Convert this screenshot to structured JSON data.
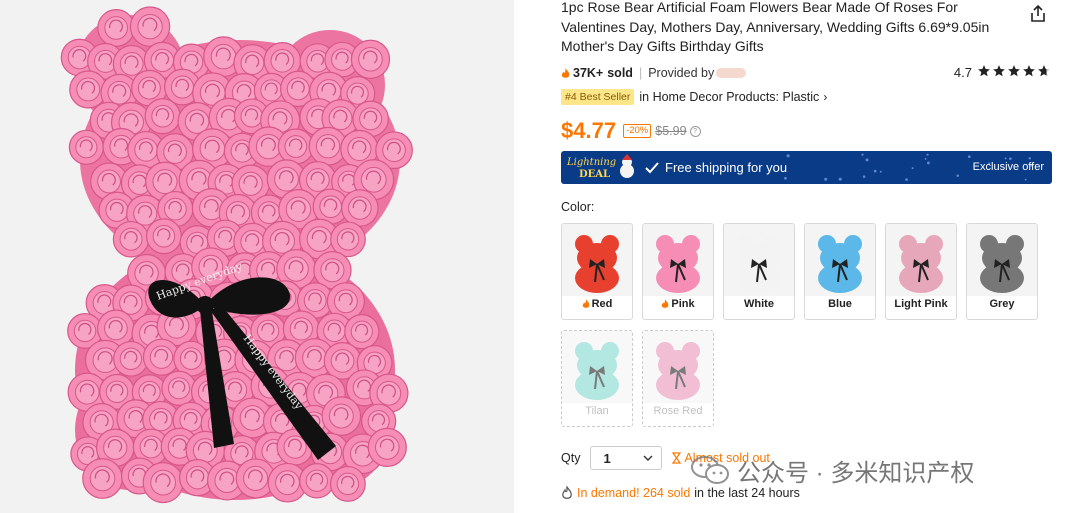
{
  "product": {
    "title": "1pc Rose Bear Artificial Foam Flowers Bear Made Of Roses For Valentines Day, Mothers Day, Anniversary, Wedding Gifts 6.69*9.05in Mother's Day Gifts Birthday Gifts",
    "sold_count": "37K+",
    "sold_label": "sold",
    "provided_by": "Provided by",
    "rating": "4.7",
    "stars_value": 4.7,
    "best_seller_badge": "#4 Best Seller",
    "best_seller_category": "in Home Decor Products: Plastic",
    "price": "$4.77",
    "discount": "-20%",
    "original_price": "$5.99",
    "info_symbol": "?"
  },
  "banner": {
    "lightning": "Lightning",
    "deal": "DEAL",
    "free_shipping": "Free shipping for you",
    "exclusive": "Exclusive offer",
    "background_color": "#0a3b86"
  },
  "color_label": "Color:",
  "colors": [
    {
      "label": "Red",
      "hot": true,
      "available": true,
      "color": "#e8402e",
      "bow": "#222222"
    },
    {
      "label": "Pink",
      "hot": true,
      "available": true,
      "color": "#f58db4",
      "bow": "#222222"
    },
    {
      "label": "White",
      "hot": false,
      "available": true,
      "color": "#f3f3f3",
      "bow": "#222222"
    },
    {
      "label": "Blue",
      "hot": false,
      "available": true,
      "color": "#5bb8e8",
      "bow": "#222222"
    },
    {
      "label": "Light Pink",
      "hot": false,
      "available": true,
      "color": "#e7a7ba",
      "bow": "#222222"
    },
    {
      "label": "Grey",
      "hot": false,
      "available": true,
      "color": "#777777",
      "bow": "#222222"
    },
    {
      "label": "Tilan",
      "hot": false,
      "available": false,
      "color": "#7fd8cf",
      "bow": "#222222"
    },
    {
      "label": "Rose Red",
      "hot": false,
      "available": false,
      "color": "#eb93b7",
      "bow": "#222222"
    }
  ],
  "quantity": {
    "label": "Qty",
    "value": "1",
    "almost_sold_out": "Almost sold out"
  },
  "demand": {
    "prefix": "In demand! 264 sold",
    "suffix": "in the last 24 hours"
  },
  "watermark": "公众号 · 多米知识产权",
  "accent_color": "#fb7701",
  "main_image_bow_text": "Happy everyday"
}
